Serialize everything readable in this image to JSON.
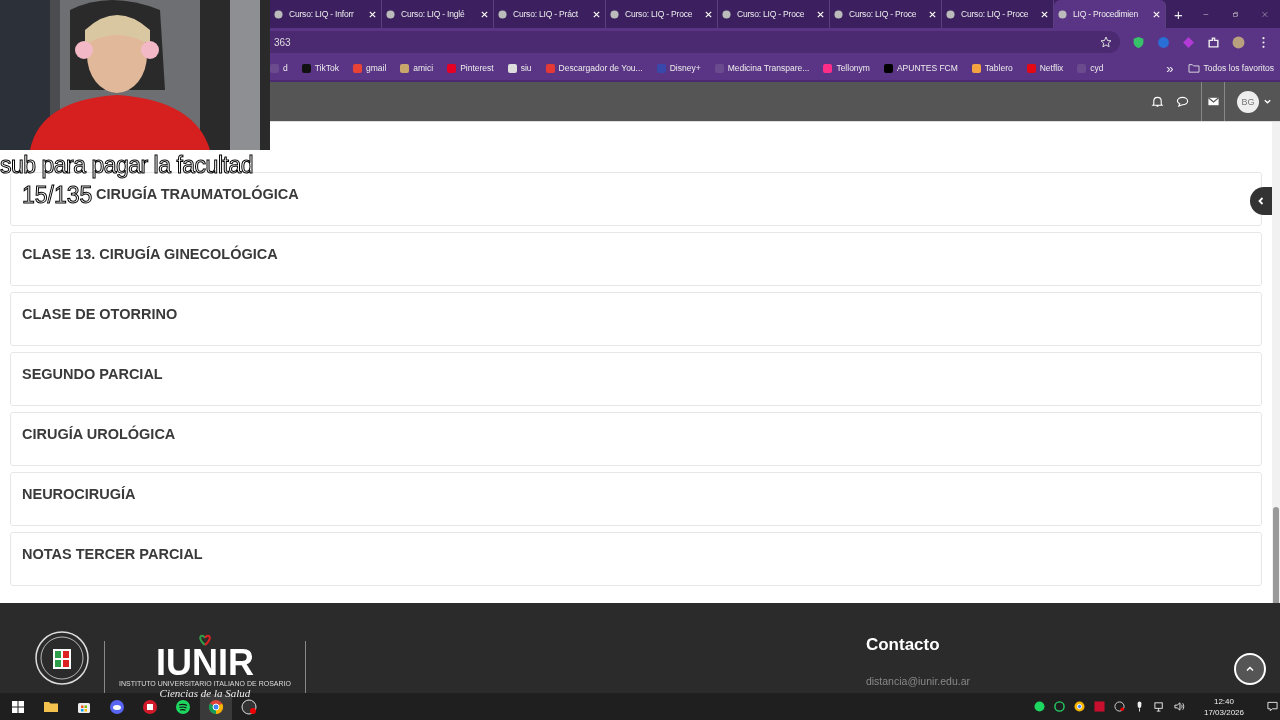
{
  "browser": {
    "tabs": [
      {
        "label": "Curso: LIQ - Inforr",
        "selected": false
      },
      {
        "label": "Curso: LIQ - Inglé",
        "selected": false
      },
      {
        "label": "Curso: LIQ - Práct",
        "selected": false
      },
      {
        "label": "Curso: LIQ - Proce",
        "selected": false
      },
      {
        "label": "Curso: LIQ - Proce",
        "selected": false
      },
      {
        "label": "Curso: LIQ - Proce",
        "selected": false
      },
      {
        "label": "Curso: LIQ - Proce",
        "selected": false
      },
      {
        "label": "LIQ - Procedimien",
        "selected": true
      }
    ],
    "new_tab": "+",
    "address": "363",
    "bookmarks": [
      {
        "label": "d",
        "color": "#6b4a8e"
      },
      {
        "label": "TikTok",
        "color": "#111111"
      },
      {
        "label": "gmail",
        "color": "#ea4335"
      },
      {
        "label": "amici",
        "color": "#c9a66b"
      },
      {
        "label": "Pinterest",
        "color": "#e60023"
      },
      {
        "label": "siu",
        "color": "#dddddd"
      },
      {
        "label": "Descargador de You...",
        "color": "#e53935"
      },
      {
        "label": "Disney+",
        "color": "#3949ab"
      },
      {
        "label": "Medicina Transpare...",
        "color": "#6b4a8e"
      },
      {
        "label": "Tellonym",
        "color": "#ff2d87"
      },
      {
        "label": "APUNTES FCM",
        "color": "#000000"
      },
      {
        "label": "Tablero",
        "color": "#f4a340"
      },
      {
        "label": "Netflix",
        "color": "#e50914"
      },
      {
        "label": "cyd",
        "color": "#6b4a8e"
      }
    ],
    "more": "»",
    "all_bookmarks": "Todos los favoritos"
  },
  "site": {
    "user_initials": "BG",
    "sections": [
      {
        "title": "CIRUGÍA TRAUMATOLÓGICA"
      },
      {
        "title": "CLASE 13. CIRUGÍA GINECOLÓGICA"
      },
      {
        "title": "CLASE DE OTORRINO"
      },
      {
        "title": "SEGUNDO PARCIAL"
      },
      {
        "title": "CIRUGÍA UROLÓGICA"
      },
      {
        "title": "NEUROCIRUGÍA"
      },
      {
        "title": "NOTAS TERCER PARCIAL"
      }
    ],
    "footer": {
      "logo": "IUNIR",
      "logo_subtitle": "INSTITUTO UNIVERSITARIO ITALIANO DE ROSARIO",
      "logo_tagline": "Ciencias de la Salud",
      "contact_heading": "Contacto",
      "email": "distancia@iunir.edu.ar"
    }
  },
  "overlay": {
    "caption": "sub para pagar la facultad",
    "counter": "15/135"
  },
  "taskbar": {
    "time": "12:40",
    "date": "17/03/2026"
  }
}
